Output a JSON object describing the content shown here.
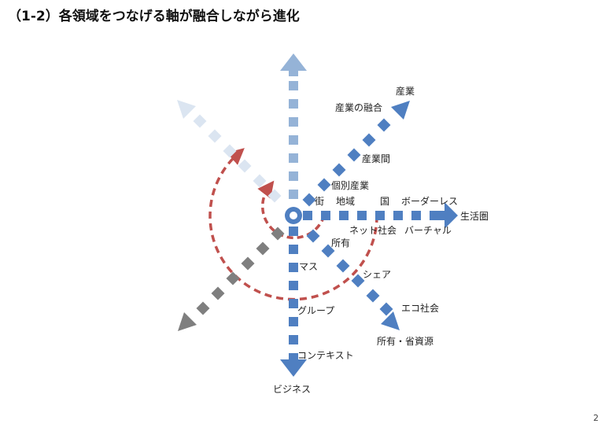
{
  "title": "（1-2）各領域をつなげる軸が融合しながら進化",
  "page_number": "2",
  "colors": {
    "blue": "#4f7fc1",
    "light_blue": "#95b3d7",
    "very_light_blue": "#dbe5f1",
    "gray": "#7f7f7f",
    "red_dashed": "#c0504d"
  },
  "labels": {
    "sangyo": "産業",
    "sangyo_no_yugo": "産業の融合",
    "sangyo_kan": "産業間",
    "kobetsu_sangyo": "個別産業",
    "machi": "街",
    "chiiki": "地域",
    "kuni": "国",
    "borderless": "ボーダーレス",
    "seikatsuken": "生活圏",
    "net_shakai": "ネット社会",
    "virtual": "バーチャル",
    "shoyu": "所有",
    "mass": "マス",
    "share": "シェア",
    "group": "グループ",
    "eco_shakai": "エコ社会",
    "shoyu_shoshigen": "所有・省資源",
    "context": "コンテキスト",
    "business": "ビジネス"
  }
}
